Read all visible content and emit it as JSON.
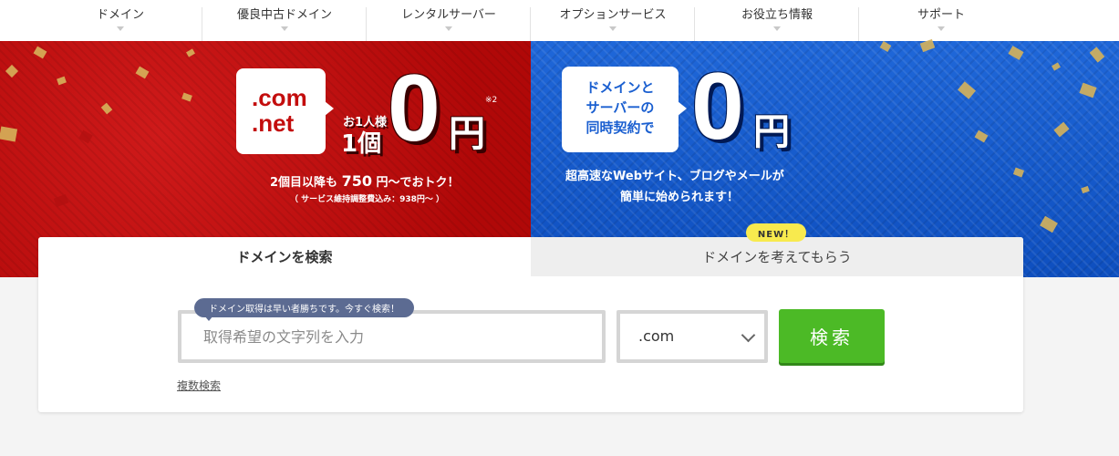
{
  "nav": {
    "items": [
      {
        "label": "ドメイン"
      },
      {
        "label": "優良中古ドメイン"
      },
      {
        "label": "レンタルサーバー"
      },
      {
        "label": "オプションサービス"
      },
      {
        "label": "お役立ち情報"
      },
      {
        "label": "サポート"
      }
    ]
  },
  "hero_left": {
    "tld_line1": ".com",
    "tld_line2": ".net",
    "per_person": "お1人様",
    "one_item": "1個",
    "price_zero": "0",
    "yen": "円",
    "footnote": "※2",
    "subtext_a": "2個目以降も",
    "subtext_price": "750",
    "subtext_b": "円～でおトク！",
    "fee_note": "（ サービス維持調整費込み：938円～ ）"
  },
  "hero_right": {
    "bubble_line1": "ドメインと",
    "bubble_line2": "サーバーの",
    "bubble_line3": "同時契約で",
    "price_zero": "0",
    "yen": "円",
    "tagline1": "超高速なWebサイト、ブログやメールが",
    "tagline2": "簡単に始められます！"
  },
  "search_panel": {
    "tab_search": "ドメインを検索",
    "tab_suggest": "ドメインを考えてもらう",
    "new_badge": "NEW！",
    "hint": "ドメイン取得は早い者勝ちです。今すぐ検索！",
    "input_placeholder": "取得希望の文字列を入力",
    "tld_selected": ".com",
    "search_button": "検索",
    "multi_search": "複数検索"
  },
  "colors": {
    "red_bg": "#c30d0d",
    "blue_bg": "#1a5fd0",
    "search_green": "#4cba26",
    "badge_yellow": "#f8ea4e"
  }
}
